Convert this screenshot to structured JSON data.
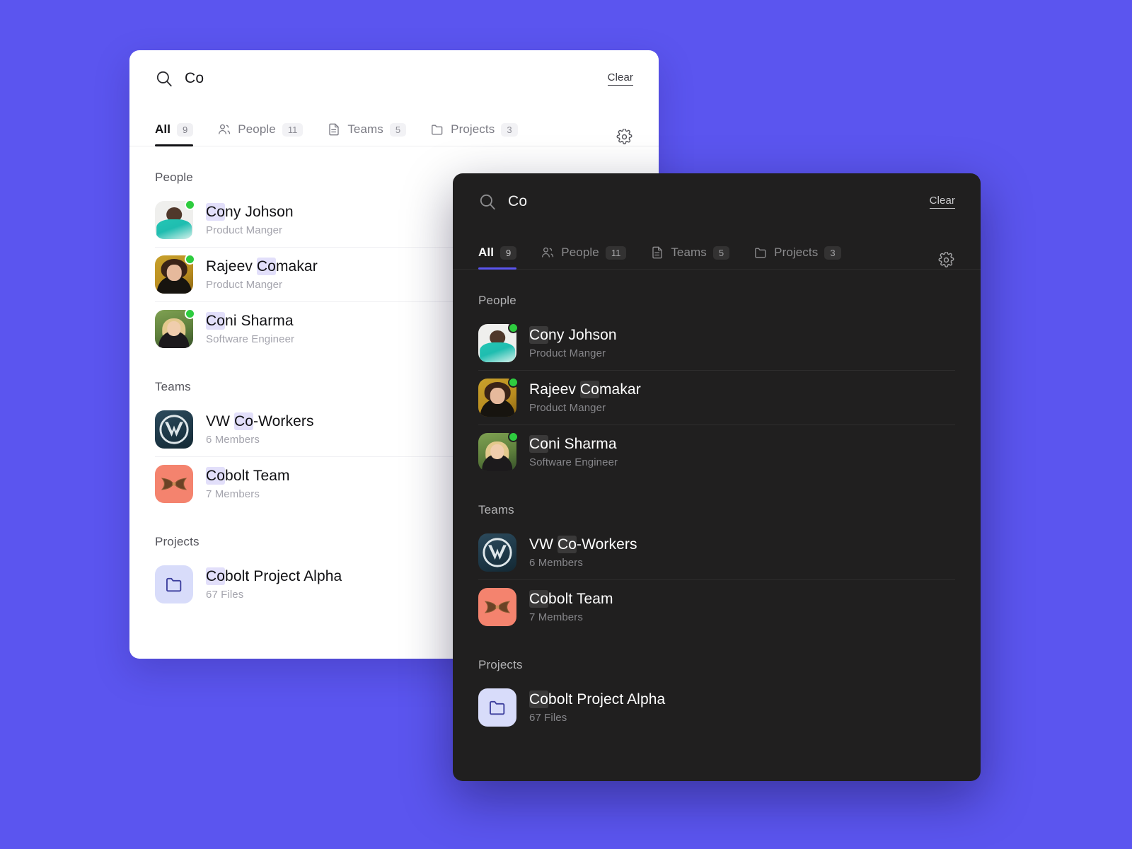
{
  "background_color": "#5B55EF",
  "accent_color": "#5B55EF",
  "highlight_color_light": "#E2DFFA",
  "highlight_color_dark": "#3A3939",
  "status_color": "#2ECC3F",
  "search": {
    "query": "Co",
    "icon": "search-icon",
    "clear_label": "Clear"
  },
  "tabs": [
    {
      "label": "All",
      "count": "9",
      "icon": "none",
      "active": true
    },
    {
      "label": "People",
      "count": "11",
      "icon": "people-icon",
      "active": false
    },
    {
      "label": "Teams",
      "count": "5",
      "icon": "document-icon",
      "active": false
    },
    {
      "label": "Projects",
      "count": "3",
      "icon": "folder-icon",
      "active": false
    }
  ],
  "settings_icon": "gear-icon",
  "sections": [
    {
      "heading": "People",
      "items": [
        {
          "pre": "",
          "match": "Co",
          "post": "ny Johson",
          "subtitle": "Product Manger",
          "avatar": "av-cony",
          "online": true
        },
        {
          "pre": "Rajeev ",
          "match": "Co",
          "post": "makar",
          "subtitle": "Product Manger",
          "avatar": "av-rajeev",
          "online": true
        },
        {
          "pre": "",
          "match": "Co",
          "post": "ni Sharma",
          "subtitle": "Software Engineer",
          "avatar": "av-coni",
          "online": true
        }
      ]
    },
    {
      "heading": "Teams",
      "items": [
        {
          "pre": "VW ",
          "match": "Co",
          "post": "-Workers",
          "subtitle": "6 Members",
          "avatar": "av-vw",
          "online": false
        },
        {
          "pre": "",
          "match": "Co",
          "post": "bolt Team",
          "subtitle": "7 Members",
          "avatar": "av-cobolt",
          "online": false
        }
      ]
    },
    {
      "heading": "Projects",
      "items": [
        {
          "pre": "",
          "match": "Co",
          "post": "bolt Project Alpha",
          "subtitle": "67 Files",
          "avatar": "tile-folder",
          "online": false
        }
      ]
    }
  ],
  "panels": {
    "light": {
      "theme": "light"
    },
    "dark": {
      "theme": "dark"
    }
  }
}
